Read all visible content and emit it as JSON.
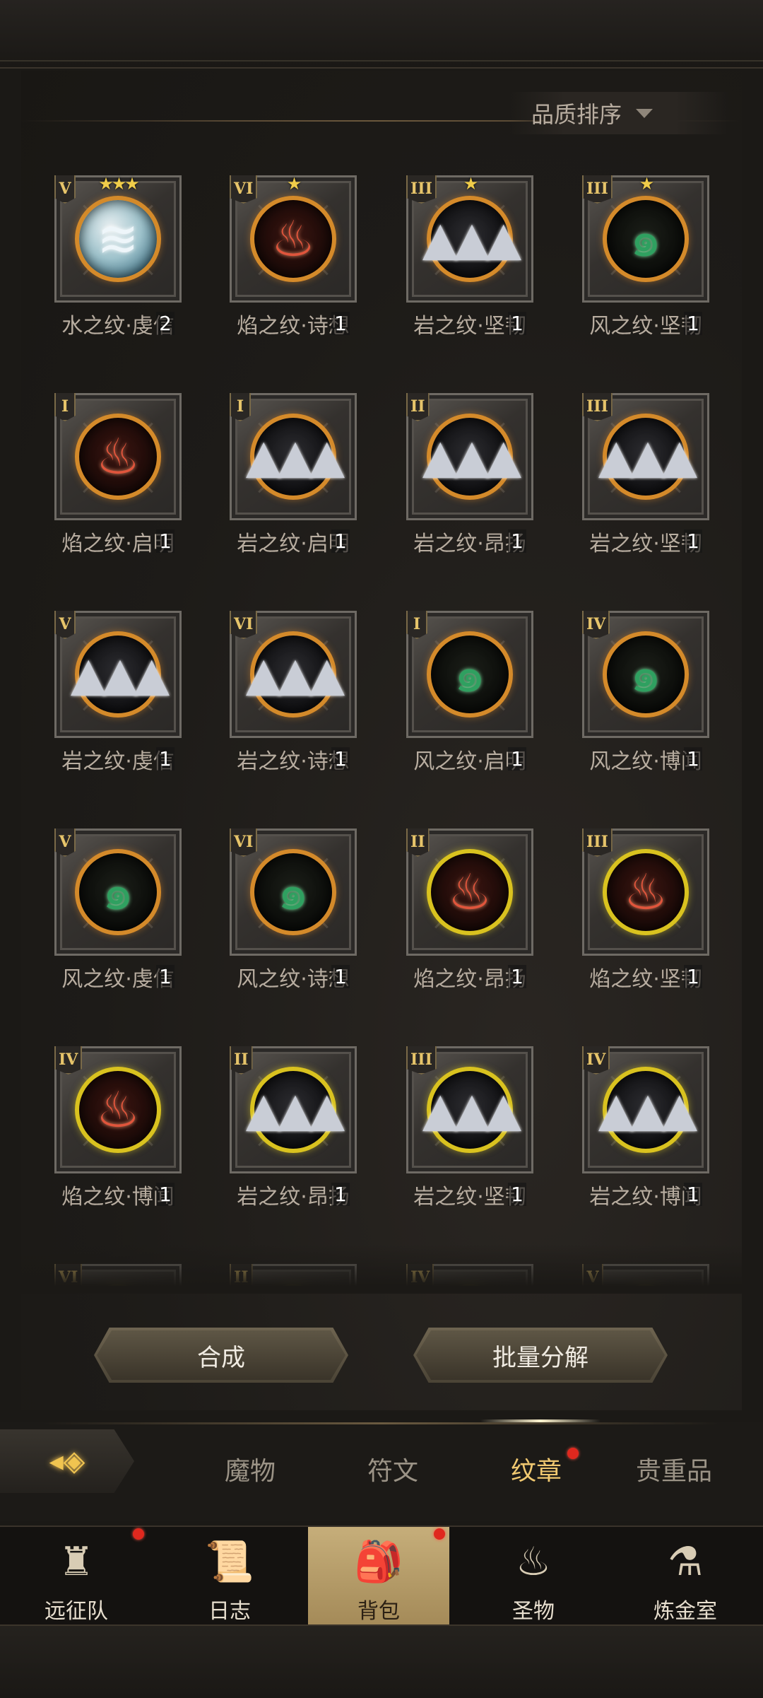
{
  "sort": {
    "label": "品质排序",
    "icon": "caret-down-icon"
  },
  "items": [
    {
      "name": "水之纹·虔信",
      "tier": "V",
      "stars": 3,
      "qty": "2",
      "element": "water",
      "ring": "orange"
    },
    {
      "name": "焰之纹·诗想",
      "tier": "VI",
      "stars": 1,
      "qty": "1",
      "element": "fire",
      "ring": "orange"
    },
    {
      "name": "岩之纹·坚韧",
      "tier": "III",
      "stars": 1,
      "qty": "1",
      "element": "rock",
      "ring": "orange"
    },
    {
      "name": "风之纹·坚韧",
      "tier": "III",
      "stars": 1,
      "qty": "1",
      "element": "wind",
      "ring": "orange"
    },
    {
      "name": "焰之纹·启明",
      "tier": "I",
      "stars": 0,
      "qty": "1",
      "element": "fire",
      "ring": "orange"
    },
    {
      "name": "岩之纹·启明",
      "tier": "I",
      "stars": 0,
      "qty": "1",
      "element": "rock",
      "ring": "orange"
    },
    {
      "name": "岩之纹·昂扬",
      "tier": "II",
      "stars": 0,
      "qty": "1",
      "element": "rock",
      "ring": "orange"
    },
    {
      "name": "岩之纹·坚韧",
      "tier": "III",
      "stars": 0,
      "qty": "1",
      "element": "rock",
      "ring": "orange"
    },
    {
      "name": "岩之纹·虔信",
      "tier": "V",
      "stars": 0,
      "qty": "1",
      "element": "rock",
      "ring": "orange"
    },
    {
      "name": "岩之纹·诗想",
      "tier": "VI",
      "stars": 0,
      "qty": "1",
      "element": "rock",
      "ring": "orange"
    },
    {
      "name": "风之纹·启明",
      "tier": "I",
      "stars": 0,
      "qty": "1",
      "element": "wind",
      "ring": "orange"
    },
    {
      "name": "风之纹·博闻",
      "tier": "IV",
      "stars": 0,
      "qty": "1",
      "element": "wind",
      "ring": "orange"
    },
    {
      "name": "风之纹·虔信",
      "tier": "V",
      "stars": 0,
      "qty": "1",
      "element": "wind",
      "ring": "orange"
    },
    {
      "name": "风之纹·诗想",
      "tier": "VI",
      "stars": 0,
      "qty": "1",
      "element": "wind",
      "ring": "orange"
    },
    {
      "name": "焰之纹·昂扬",
      "tier": "II",
      "stars": 0,
      "qty": "1",
      "element": "fire",
      "ring": "yellow"
    },
    {
      "name": "焰之纹·坚韧",
      "tier": "III",
      "stars": 0,
      "qty": "1",
      "element": "fire",
      "ring": "yellow"
    },
    {
      "name": "焰之纹·博闻",
      "tier": "IV",
      "stars": 0,
      "qty": "1",
      "element": "fire",
      "ring": "yellow"
    },
    {
      "name": "岩之纹·昂扬",
      "tier": "II",
      "stars": 0,
      "qty": "1",
      "element": "rock",
      "ring": "yellow"
    },
    {
      "name": "岩之纹·坚韧",
      "tier": "III",
      "stars": 0,
      "qty": "1",
      "element": "rock",
      "ring": "yellow"
    },
    {
      "name": "岩之纹·博闻",
      "tier": "IV",
      "stars": 0,
      "qty": "1",
      "element": "rock",
      "ring": "yellow"
    },
    {
      "name": "",
      "tier": "VI",
      "stars": 0,
      "qty": "",
      "element": "fire",
      "ring": "yellow"
    },
    {
      "name": "",
      "tier": "II",
      "stars": 0,
      "qty": "",
      "element": "rock",
      "ring": "yellow"
    },
    {
      "name": "",
      "tier": "IV",
      "stars": 0,
      "qty": "",
      "element": "rock",
      "ring": "yellow"
    },
    {
      "name": "",
      "tier": "V",
      "stars": 0,
      "qty": "",
      "element": "rock",
      "ring": "yellow"
    }
  ],
  "actions": {
    "compose": "合成",
    "batch_decompose": "批量分解"
  },
  "category_tabs": [
    {
      "label": "魔物",
      "active": false,
      "badge": false
    },
    {
      "label": "符文",
      "active": false,
      "badge": false
    },
    {
      "label": "纹章",
      "active": true,
      "badge": true
    },
    {
      "label": "贵重品",
      "active": false,
      "badge": false
    }
  ],
  "bottom_nav": [
    {
      "label": "远征队",
      "icon": "viking-helmet-icon",
      "active": false,
      "badge": true
    },
    {
      "label": "日志",
      "icon": "scroll-icon",
      "active": false,
      "badge": false
    },
    {
      "label": "背包",
      "icon": "backpack-icon",
      "active": true,
      "badge": true
    },
    {
      "label": "圣物",
      "icon": "torch-icon",
      "active": false,
      "badge": false
    },
    {
      "label": "炼金室",
      "icon": "alchemy-icon",
      "active": false,
      "badge": false
    }
  ],
  "colors": {
    "accent_gold": "#f0c870",
    "ring_orange": "#d48a2a",
    "ring_yellow": "#d9c21f",
    "badge_red": "#e0281e"
  }
}
